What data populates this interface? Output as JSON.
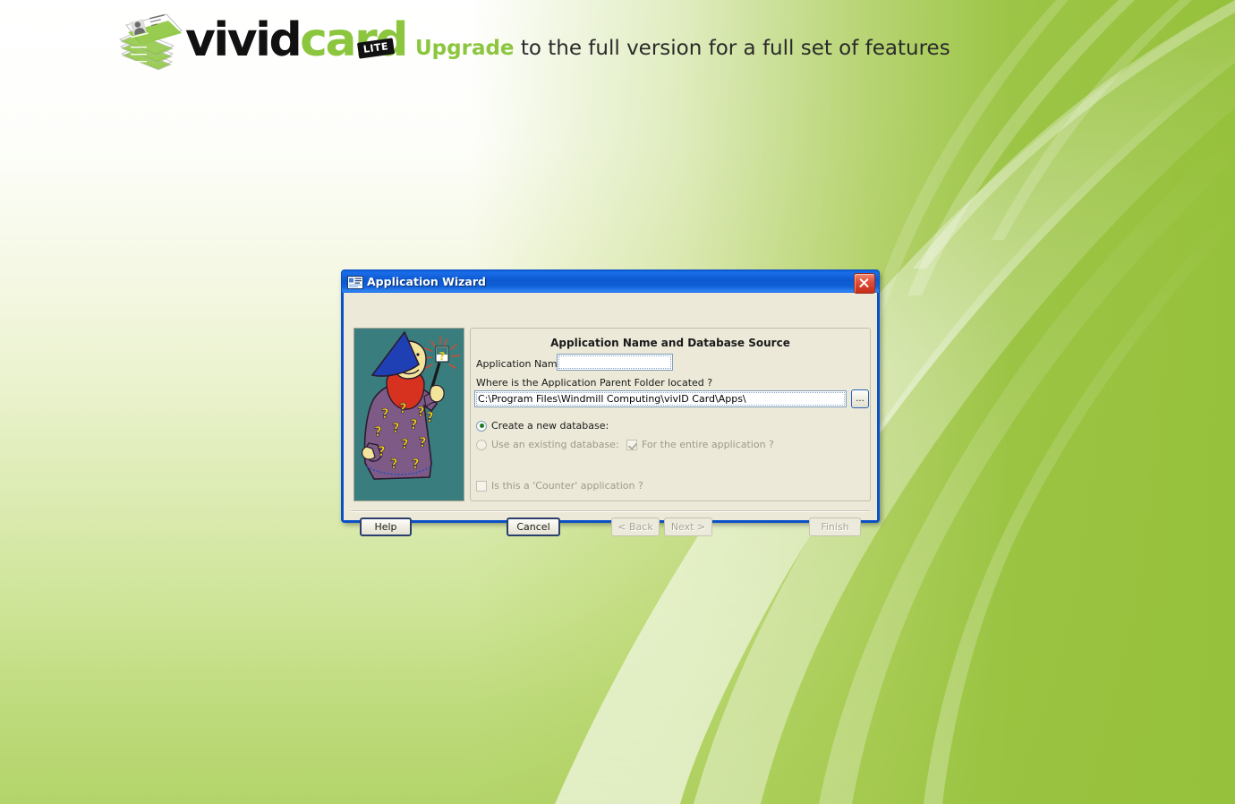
{
  "banner": {
    "logo_icon": "id-card-stack-icon",
    "wordmark_part1": "vivid",
    "wordmark_part2": "card",
    "lite_badge": "LITE",
    "tagline_highlight": "Upgrade",
    "tagline_rest": " to the full version for a full set of features",
    "colors": {
      "brand_green": "#8cc63e",
      "brand_black": "#111111"
    }
  },
  "window": {
    "title": "Application Wizard",
    "title_icon": "application-card-icon",
    "close_icon": "close-icon",
    "titlebar_color": "#0c5fd8",
    "border_color": "#0a51c8",
    "face_color": "#ece9d8"
  },
  "dialog": {
    "illustration": "wizard-illustration",
    "group_title": "Application Name and Database Source",
    "app_name_label": "Application Name:",
    "app_name_value": "",
    "app_name_placeholder": "",
    "parent_folder_label": "Where is the Application Parent Folder located ?",
    "parent_folder_value": "C:\\Program Files\\Windmill Computing\\vivID Card\\Apps\\",
    "browse_label": "...",
    "radio_new_db": "Create a new database:",
    "radio_existing_db": "Use an existing database:",
    "checkbox_entire_app": "For the entire application ?",
    "checkbox_counter_app": "Is this a 'Counter' application ?",
    "state": {
      "new_db_selected": true,
      "existing_db_selected": false,
      "existing_db_enabled": false,
      "entire_app_checked": true,
      "entire_app_enabled": false,
      "counter_app_checked": false,
      "counter_app_enabled": false
    }
  },
  "footer": {
    "help": "Help",
    "cancel": "Cancel",
    "back": "< Back",
    "next": "Next >",
    "finish": "Finish",
    "back_enabled": false,
    "next_enabled": false,
    "finish_enabled": false
  }
}
